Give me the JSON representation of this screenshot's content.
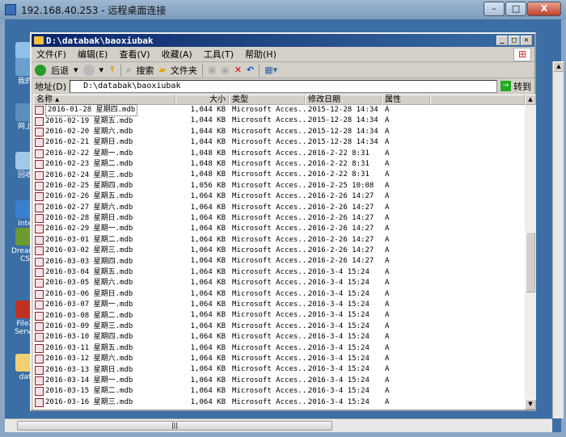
{
  "rdp": {
    "title": "192.168.40.253 - 远程桌面连接",
    "min": "–",
    "max": "□",
    "close": "X"
  },
  "desktop_icons": [
    {
      "label": "我的",
      "color": "#8fc0e8"
    },
    {
      "label": "我的",
      "color": "#6aa0d0"
    },
    {
      "label": "网上",
      "color": "#5a90c0"
    },
    {
      "label": "回收",
      "color": "#a0c8e8"
    },
    {
      "label": "Inte Expl",
      "color": "#3a80d0"
    },
    {
      "label": "Dreamw CS",
      "color": "#6a9a30"
    },
    {
      "label": "FileZ Serve",
      "color": "#c03020"
    },
    {
      "label": "dat",
      "color": "#f0d070"
    }
  ],
  "explorer": {
    "title": "D:\\databak\\baoxiubak",
    "menu": [
      "文件(F)",
      "编辑(E)",
      "查看(V)",
      "收藏(A)",
      "工具(T)",
      "帮助(H)"
    ],
    "toolbar": {
      "back": "后退",
      "search": "搜索",
      "folders": "文件夹"
    },
    "address": {
      "label": "地址(D)",
      "value": "D:\\databak\\baoxiubak",
      "go": "转到"
    },
    "columns": [
      "名称",
      "大小",
      "类型",
      "修改日期",
      "属性"
    ],
    "files": [
      [
        "2016-01-28 星期四.mdb",
        "1,044 KB",
        "Microsoft Acces...",
        "2015-12-28 14:34",
        "A"
      ],
      [
        "2016-02-19 星期五.mdb",
        "1,044 KB",
        "Microsoft Acces...",
        "2015-12-28 14:34",
        "A"
      ],
      [
        "2016-02-20 星期六.mdb",
        "1,044 KB",
        "Microsoft Acces...",
        "2015-12-28 14:34",
        "A"
      ],
      [
        "2016-02-21 星期日.mdb",
        "1,044 KB",
        "Microsoft Acces...",
        "2015-12-28 14:34",
        "A"
      ],
      [
        "2016-02-22 星期一.mdb",
        "1,048 KB",
        "Microsoft Acces...",
        "2016-2-22 8:31",
        "A"
      ],
      [
        "2016-02-23 星期二.mdb",
        "1,048 KB",
        "Microsoft Acces...",
        "2016-2-22 8:31",
        "A"
      ],
      [
        "2016-02-24 星期三.mdb",
        "1,048 KB",
        "Microsoft Acces...",
        "2016-2-22 8:31",
        "A"
      ],
      [
        "2016-02-25 星期四.mdb",
        "1,056 KB",
        "Microsoft Acces...",
        "2016-2-25 10:08",
        "A"
      ],
      [
        "2016-02-26 星期五.mdb",
        "1,064 KB",
        "Microsoft Acces...",
        "2016-2-26 14:27",
        "A"
      ],
      [
        "2016-02-27 星期六.mdb",
        "1,064 KB",
        "Microsoft Acces...",
        "2016-2-26 14:27",
        "A"
      ],
      [
        "2016-02-28 星期日.mdb",
        "1,064 KB",
        "Microsoft Acces...",
        "2016-2-26 14:27",
        "A"
      ],
      [
        "2016-02-29 星期一.mdb",
        "1,064 KB",
        "Microsoft Acces...",
        "2016-2-26 14:27",
        "A"
      ],
      [
        "2016-03-01 星期二.mdb",
        "1,064 KB",
        "Microsoft Acces...",
        "2016-2-26 14:27",
        "A"
      ],
      [
        "2016-03-02 星期三.mdb",
        "1,064 KB",
        "Microsoft Acces...",
        "2016-2-26 14:27",
        "A"
      ],
      [
        "2016-03-03 星期四.mdb",
        "1,064 KB",
        "Microsoft Acces...",
        "2016-2-26 14:27",
        "A"
      ],
      [
        "2016-03-04 星期五.mdb",
        "1,064 KB",
        "Microsoft Acces...",
        "2016-3-4 15:24",
        "A"
      ],
      [
        "2016-03-05 星期六.mdb",
        "1,064 KB",
        "Microsoft Acces...",
        "2016-3-4 15:24",
        "A"
      ],
      [
        "2016-03-06 星期日.mdb",
        "1,064 KB",
        "Microsoft Acces...",
        "2016-3-4 15:24",
        "A"
      ],
      [
        "2016-03-07 星期一.mdb",
        "1,064 KB",
        "Microsoft Acces...",
        "2016-3-4 15:24",
        "A"
      ],
      [
        "2016-03-08 星期二.mdb",
        "1,064 KB",
        "Microsoft Acces...",
        "2016-3-4 15:24",
        "A"
      ],
      [
        "2016-03-09 星期三.mdb",
        "1,064 KB",
        "Microsoft Acces...",
        "2016-3-4 15:24",
        "A"
      ],
      [
        "2016-03-10 星期四.mdb",
        "1,064 KB",
        "Microsoft Acces...",
        "2016-3-4 15:24",
        "A"
      ],
      [
        "2016-03-11 星期五.mdb",
        "1,064 KB",
        "Microsoft Acces...",
        "2016-3-4 15:24",
        "A"
      ],
      [
        "2016-03-12 星期六.mdb",
        "1,064 KB",
        "Microsoft Acces...",
        "2016-3-4 15:24",
        "A"
      ],
      [
        "2016-03-13 星期日.mdb",
        "1,064 KB",
        "Microsoft Acces...",
        "2016-3-4 15:24",
        "A"
      ],
      [
        "2016-03-14 星期一.mdb",
        "1,064 KB",
        "Microsoft Acces...",
        "2016-3-4 15:24",
        "A"
      ],
      [
        "2016-03-15 星期二.mdb",
        "1,064 KB",
        "Microsoft Acces...",
        "2016-3-4 15:24",
        "A"
      ],
      [
        "2016-03-16 星期三.mdb",
        "1,064 KB",
        "Microsoft Acces...",
        "2016-3-4 15:24",
        "A"
      ]
    ]
  }
}
